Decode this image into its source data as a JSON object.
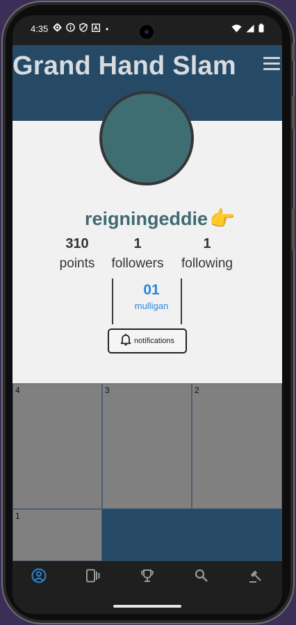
{
  "status_bar": {
    "time": "4:35",
    "dot": "•"
  },
  "header": {
    "title": "Grand Hand Slam",
    "menu_icon": "hamburger-menu-icon"
  },
  "profile": {
    "username": "reigningeddie",
    "emoji": "👉",
    "avatar_color": "#3f6e72",
    "stats": [
      {
        "value": "310",
        "label": "points"
      },
      {
        "value": "1",
        "label": "followers"
      },
      {
        "value": "1",
        "label": "following"
      }
    ],
    "mulligan": {
      "value": "01",
      "label": "mulligan"
    },
    "notifications_label": "notifications"
  },
  "grid": {
    "tiles": [
      "4",
      "3",
      "2",
      "1"
    ]
  },
  "bottom_nav": {
    "items": [
      "profile-icon",
      "cards-icon",
      "trophy-icon",
      "search-icon",
      "gavel-icon"
    ],
    "active": "profile-icon"
  },
  "colors": {
    "header": "#264a66",
    "title": "#d7dce1",
    "accent": "#2a86d6",
    "username": "#3f6a72",
    "tile": "#808080"
  }
}
